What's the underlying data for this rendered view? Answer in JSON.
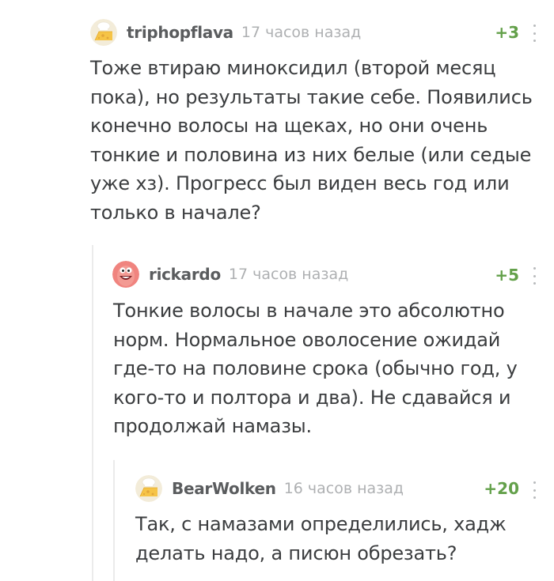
{
  "comments": [
    {
      "username": "triphopflava",
      "time": "17 часов назад",
      "rating": "+3",
      "avatar": "cheese-avatar",
      "text_lines": [
        "Тоже втираю миноксидил (второй месяц",
        "пока), но результаты такие себе. Появились",
        "конечно волосы на щеках, но они очень",
        "тонкие и половина из них белые (или седые",
        "уже хз). Прогресс был виден весь год или",
        "только в начале?"
      ]
    },
    {
      "username": "rickardo",
      "time": "17 часов назад",
      "rating": "+5",
      "avatar": "patrick-avatar",
      "text_lines": [
        "Тонкие волосы в начале это абсолютно",
        "норм. Нормальное оволосение ожидай",
        "где-то на половине срока (обычно год, у",
        "кого-то и полтора и два). Не сдавайся и",
        "продолжай намазы."
      ]
    },
    {
      "username": "BearWolken",
      "time": "16 часов назад",
      "rating": "+20",
      "avatar": "cheese-avatar",
      "text_lines": [
        "Так, с намазами определились, хадж",
        "делать надо, а писюн обрезать?"
      ]
    }
  ],
  "colors": {
    "rating": "#63a04a",
    "username": "#5a5c5e",
    "time": "#aeb0b2",
    "text": "#3b3d3f",
    "thread_line": "#ebebeb"
  }
}
